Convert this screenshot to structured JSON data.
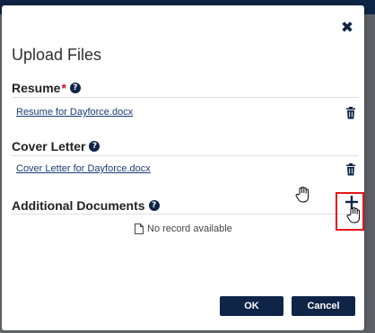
{
  "dialog": {
    "title": "Upload Files",
    "close_symbol": "✖"
  },
  "resume": {
    "label": "Resume",
    "required_marker": "*",
    "help_symbol": "?",
    "file_name": "Resume for Dayforce.docx"
  },
  "cover_letter": {
    "label": "Cover Letter",
    "help_symbol": "?",
    "file_name": "Cover Letter for Dayforce.docx"
  },
  "additional_documents": {
    "label": "Additional Documents",
    "help_symbol": "?",
    "empty_message": "No record available"
  },
  "buttons": {
    "ok_label": "OK",
    "cancel_label": "Cancel"
  },
  "icons": {
    "close": "close-icon",
    "help": "help-icon",
    "delete": "trash-icon",
    "add": "plus-icon",
    "document": "document-icon",
    "cursor": "hand-cursor-icon"
  },
  "colors": {
    "primary": "#0f2547",
    "required": "#c8102e",
    "link": "#1a3c7a",
    "highlight": "#e5141c"
  }
}
